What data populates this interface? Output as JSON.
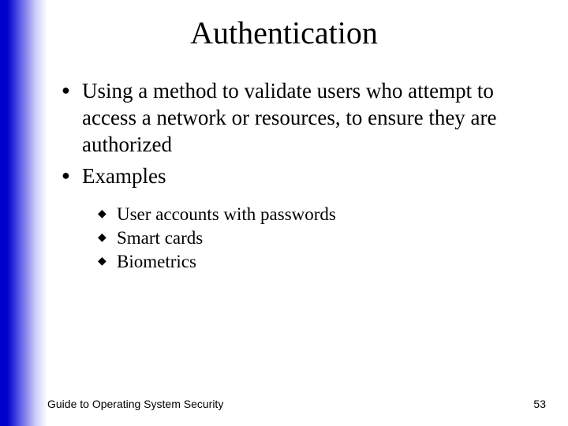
{
  "title": "Authentication",
  "bullets": {
    "l1": [
      "Using a method to validate users who attempt to access a network or resources, to ensure they are authorized",
      "Examples"
    ],
    "l2": [
      "User accounts with passwords",
      "Smart cards",
      "Biometrics"
    ]
  },
  "footer": {
    "left": "Guide to Operating System Security",
    "page": "53"
  },
  "glyphs": {
    "disc": "●",
    "diamond": "◆"
  },
  "colors": {
    "accent": "#0000cc"
  }
}
